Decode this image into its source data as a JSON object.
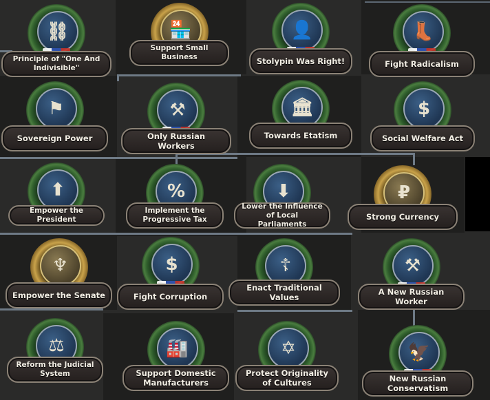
{
  "focuses": [
    {
      "id": "principle-one-indivisible",
      "label": "Principle of \"One And Indivisible\"",
      "icon": "chain-map-icon",
      "glyph": "⛓"
    },
    {
      "id": "support-small-business",
      "label": "Support Small Business",
      "icon": "shop-icon",
      "glyph": "🏪"
    },
    {
      "id": "stolypin-was-right",
      "label": "Stolypin Was Right!",
      "icon": "portrait-icon",
      "glyph": "👤"
    },
    {
      "id": "fight-radicalism",
      "label": "Fight Radicalism",
      "icon": "boot-icon",
      "glyph": "👢"
    },
    {
      "id": "sovereign-power",
      "label": "Sovereign Power",
      "icon": "russia-map-flags-icon",
      "glyph": "⚑"
    },
    {
      "id": "only-russian-workers",
      "label": "Only Russian Workers",
      "icon": "worker-factory-icon",
      "glyph": "⚒"
    },
    {
      "id": "towards-etatism",
      "label": "Towards Etatism",
      "icon": "government-building-icon",
      "glyph": "🏛"
    },
    {
      "id": "social-welfare-act",
      "label": "Social Welfare Act",
      "icon": "money-bag-crowd-icon",
      "glyph": "$"
    },
    {
      "id": "empower-the-president",
      "label": "Empower the President",
      "icon": "president-arrow-up-icon",
      "glyph": "⬆"
    },
    {
      "id": "implement-progressive-tax",
      "label": "Implement the Progressive Tax",
      "icon": "percent-tax-icon",
      "glyph": "%"
    },
    {
      "id": "lower-influence-local-parliaments",
      "label": "Lower the Influence of Local Parliaments",
      "icon": "parliament-arrow-down-icon",
      "glyph": "⬇"
    },
    {
      "id": "strong-currency",
      "label": "Strong Currency",
      "icon": "ruble-icon",
      "glyph": "₽"
    },
    {
      "id": "empower-the-senate",
      "label": "Empower the Senate",
      "icon": "angel-statue-icon",
      "glyph": "♆"
    },
    {
      "id": "fight-corruption",
      "label": "Fight Corruption",
      "icon": "hand-money-bag-icon",
      "glyph": "$"
    },
    {
      "id": "enact-traditional-values",
      "label": "Enact Traditional Values",
      "icon": "orthodox-cross-scroll-icon",
      "glyph": "☦"
    },
    {
      "id": "new-russian-worker",
      "label": "A New Russian Worker",
      "icon": "worker-hammer-icon",
      "glyph": "⚒"
    },
    {
      "id": "reform-judicial-system",
      "label": "Reform the Judicial System",
      "icon": "courthouse-gavel-icon",
      "glyph": "⚖"
    },
    {
      "id": "support-domestic-manufacturers",
      "label": "Support Domestic Manufacturers",
      "icon": "factory-money-icon",
      "glyph": "🏭"
    },
    {
      "id": "protect-originality-cultures",
      "label": "Protect Originality of Cultures",
      "icon": "religious-symbols-shield-icon",
      "glyph": "✡"
    },
    {
      "id": "new-russian-conservatism",
      "label": "New Russian Conservatism",
      "icon": "eagle-shield-icon",
      "glyph": "🦅"
    }
  ]
}
